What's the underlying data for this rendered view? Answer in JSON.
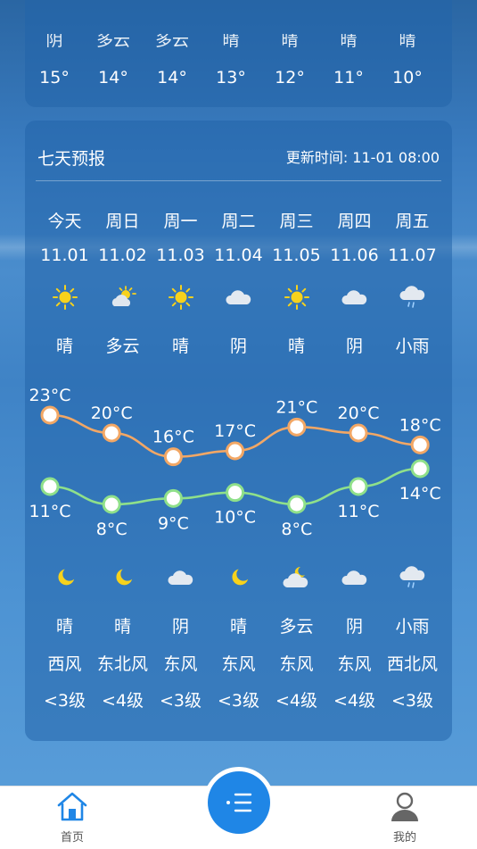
{
  "hourly": {
    "conditions": [
      "阴",
      "多云",
      "多云",
      "晴",
      "晴",
      "晴",
      "晴"
    ],
    "temps": [
      "15°",
      "14°",
      "14°",
      "13°",
      "12°",
      "11°",
      "10°"
    ]
  },
  "forecast": {
    "title": "七天预报",
    "updated": "更新时间: 11-01 08:00",
    "days": [
      {
        "name": "今天",
        "date": "11.01",
        "day_icon": "sun-icon",
        "day_cond": "晴",
        "night_icon": "moon-icon",
        "night_cond": "晴",
        "wind": "西风",
        "level": "<3级"
      },
      {
        "name": "周日",
        "date": "11.02",
        "day_icon": "partly-cloudy-icon",
        "day_cond": "多云",
        "night_icon": "moon-icon",
        "night_cond": "晴",
        "wind": "东北风",
        "level": "<4级"
      },
      {
        "name": "周一",
        "date": "11.03",
        "day_icon": "sun-icon",
        "day_cond": "晴",
        "night_icon": "cloud-icon",
        "night_cond": "阴",
        "wind": "东风",
        "level": "<3级"
      },
      {
        "name": "周二",
        "date": "11.04",
        "day_icon": "cloud-icon",
        "day_cond": "阴",
        "night_icon": "moon-icon",
        "night_cond": "晴",
        "wind": "东风",
        "level": "<3级"
      },
      {
        "name": "周三",
        "date": "11.05",
        "day_icon": "sun-icon",
        "day_cond": "晴",
        "night_icon": "cloudy-night-icon",
        "night_cond": "多云",
        "wind": "东风",
        "level": "<4级"
      },
      {
        "name": "周四",
        "date": "11.06",
        "day_icon": "cloud-icon",
        "day_cond": "阴",
        "night_icon": "cloud-icon",
        "night_cond": "阴",
        "wind": "东风",
        "level": "<4级"
      },
      {
        "name": "周五",
        "date": "11.07",
        "day_icon": "rain-icon",
        "day_cond": "小雨",
        "night_icon": "rain-icon",
        "night_cond": "小雨",
        "wind": "西北风",
        "level": "<3级"
      }
    ]
  },
  "chart_data": {
    "type": "line",
    "categories": [
      "11.01",
      "11.02",
      "11.03",
      "11.04",
      "11.05",
      "11.06",
      "11.07"
    ],
    "series": [
      {
        "values": [
          23,
          20,
          16,
          17,
          21,
          20,
          18
        ],
        "labels": [
          "23°C",
          "20°C",
          "16°C",
          "17°C",
          "21°C",
          "20°C",
          "18°C"
        ],
        "color": "#f2a765"
      },
      {
        "values": [
          11,
          8,
          9,
          10,
          8,
          11,
          14
        ],
        "labels": [
          "11°C",
          "8°C",
          "9°C",
          "10°C",
          "8°C",
          "11°C",
          "14°C"
        ],
        "color": "#8fe08a"
      }
    ]
  },
  "nav": {
    "home_label": "首页",
    "me_label": "我的",
    "accent": "#1f86e6"
  }
}
